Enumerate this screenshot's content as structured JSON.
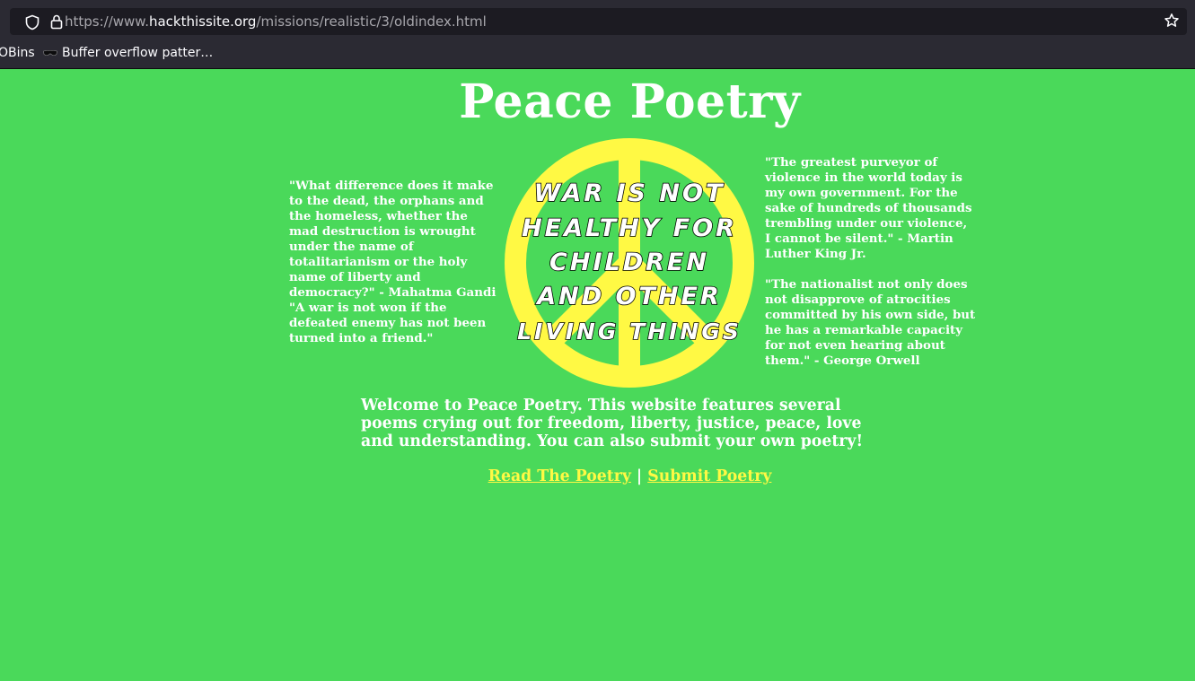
{
  "browser": {
    "url_prefix": "https://www.",
    "url_host": "hackthissite.org",
    "url_path": "/missions/realistic/3/oldindex.html",
    "bookmarks": [
      {
        "label": "OBins"
      },
      {
        "label": "Buffer overflow patter…"
      }
    ]
  },
  "page": {
    "title": "Peace Poetry",
    "image_text": [
      "WAR IS NOT",
      "HEALTHY FOR",
      "CHILDREN",
      "AND OTHER",
      "LIVING THINGS"
    ],
    "quotes_left": [
      "\"What difference does it make to the dead, the orphans and the homeless, whether the mad destruction is wrought under the name of totalitarianism or the holy name of liberty and democracy?\" - Mahatma Gandi",
      "\"A war is not won if the defeated enemy has not been turned into a friend.\""
    ],
    "quotes_right": [
      "\"The greatest purveyor of violence in the world today is my own government. For the sake of hundreds of thousands trembling under our violence, I cannot be silent.\" - Martin Luther King Jr.",
      "\"The nationalist not only does not disapprove of atrocities committed by his own side, but he has a remarkable capacity for not even hearing about them.\" - George Orwell"
    ],
    "intro": "Welcome to Peace Poetry. This website features several poems crying out for freedom, liberty, justice, peace, love and understanding. You can also submit your own poetry!",
    "links": {
      "read": "Read The Poetry",
      "separator": " | ",
      "submit": "Submit Poetry"
    }
  },
  "colors": {
    "background": "#4ad95a",
    "text": "#ffffff",
    "link": "#fff944",
    "peace_sign": "#fff944"
  }
}
